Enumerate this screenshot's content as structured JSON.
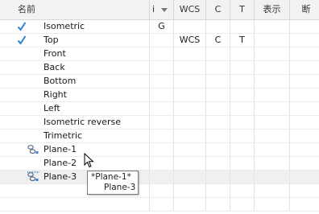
{
  "columns": {
    "name": "名前",
    "i": "i",
    "wcs": "WCS",
    "c": "C",
    "t": "T",
    "display": "表示",
    "section": "断"
  },
  "views": [
    {
      "name": "Isometric",
      "checked": true,
      "i": "G",
      "wcs": "",
      "c": "",
      "t": ""
    },
    {
      "name": "Top",
      "checked": true,
      "i": "",
      "wcs": "WCS",
      "c": "C",
      "t": "T"
    },
    {
      "name": "Front",
      "checked": false,
      "i": "",
      "wcs": "",
      "c": "",
      "t": ""
    },
    {
      "name": "Back",
      "checked": false,
      "i": "",
      "wcs": "",
      "c": "",
      "t": ""
    },
    {
      "name": "Bottom",
      "checked": false,
      "i": "",
      "wcs": "",
      "c": "",
      "t": ""
    },
    {
      "name": "Right",
      "checked": false,
      "i": "",
      "wcs": "",
      "c": "",
      "t": ""
    },
    {
      "name": "Left",
      "checked": false,
      "i": "",
      "wcs": "",
      "c": "",
      "t": ""
    },
    {
      "name": "Isometric reverse",
      "checked": false,
      "i": "",
      "wcs": "",
      "c": "",
      "t": ""
    },
    {
      "name": "Trimetric",
      "checked": false,
      "i": "",
      "wcs": "",
      "c": "",
      "t": ""
    },
    {
      "name": "Plane-1",
      "checked": false,
      "icon": "linked-plane-icon",
      "i": "",
      "wcs": "",
      "c": "",
      "t": ""
    },
    {
      "name": "Plane-2",
      "checked": false,
      "i": "",
      "wcs": "",
      "c": "",
      "t": ""
    },
    {
      "name": "Plane-3",
      "checked": false,
      "icon": "linked-plane-selected-icon",
      "i": "",
      "wcs": "",
      "c": "",
      "t": "",
      "hover": true
    }
  ],
  "tooltip": {
    "line1": "*Plane-1*",
    "line2": "Plane-3"
  },
  "colors": {
    "check": "#2f7fd1",
    "header_bg": "#f2f2f2",
    "hover_row": "#f0f0f0"
  }
}
